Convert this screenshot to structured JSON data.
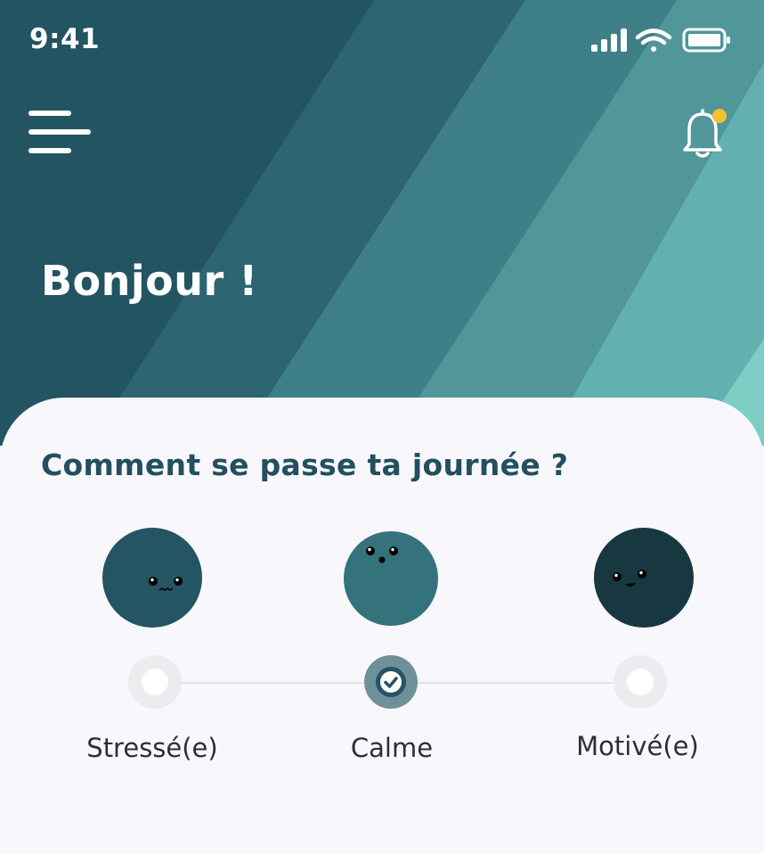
{
  "status_bar": {
    "time": "9:41",
    "icons": [
      "cellular-signal-icon",
      "wifi-icon",
      "battery-icon"
    ]
  },
  "header": {
    "menu_icon": "hamburger-menu-icon",
    "notification_icon": "bell-icon",
    "notification_dot_color": "#f2c230",
    "greeting": "Bonjour !"
  },
  "mood_check": {
    "question": "Comment se passe ta journée ?",
    "options": [
      {
        "label": "Stressé(e)",
        "selected": false,
        "color": "#255463"
      },
      {
        "label": "Calme",
        "selected": true,
        "color": "#34737b"
      },
      {
        "label": "Motivé(e)",
        "selected": false,
        "color": "#183841"
      }
    ]
  },
  "colors": {
    "header_dark": "#225462",
    "header_light": "#7cd3c8",
    "accent": "#234f5f",
    "background": "#f8f7fc"
  }
}
